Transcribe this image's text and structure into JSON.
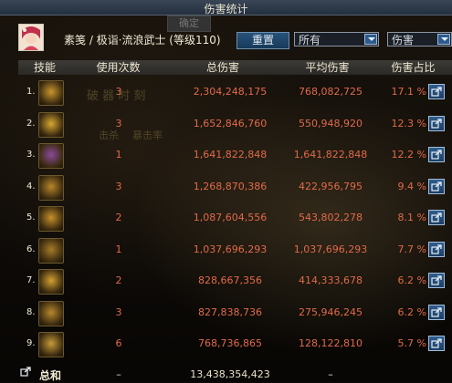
{
  "window": {
    "title": "伤害统计"
  },
  "ghost": {
    "confirm": "确定",
    "t1": "破 器 时 刻",
    "t2": "击杀",
    "t3": "暴击率"
  },
  "header": {
    "character": "素笺 / 极诣·流浪武士 (等级110)",
    "reset_label": "重置",
    "filter_selected": "所有",
    "type_selected": "伤害"
  },
  "columns": [
    "技能",
    "使用次数",
    "总伤害",
    "平均伤害",
    "伤害占比"
  ],
  "rows": [
    {
      "index": "1.",
      "count": "3",
      "total": "2,304,248,175",
      "avg": "768,082,725",
      "pct": "17.1 %",
      "icon": "skill-gold-slash-icon",
      "color": "#c9962e"
    },
    {
      "index": "2.",
      "count": "3",
      "total": "1,652,846,760",
      "avg": "550,948,920",
      "pct": "12.3 %",
      "icon": "skill-crescent-icon",
      "color": "#d8a833"
    },
    {
      "index": "3.",
      "count": "1",
      "total": "1,641,822,848",
      "avg": "1,641,822,848",
      "pct": "12.2 %",
      "icon": "skill-purple-burst-icon",
      "color": "#8a4a9a"
    },
    {
      "index": "4.",
      "count": "3",
      "total": "1,268,870,386",
      "avg": "422,956,795",
      "pct": "9.4 %",
      "icon": "skill-cross-slash-icon",
      "color": "#b8862a"
    },
    {
      "index": "5.",
      "count": "2",
      "total": "1,087,604,556",
      "avg": "543,802,278",
      "pct": "8.1 %",
      "icon": "skill-dash-icon",
      "color": "#c7902a"
    },
    {
      "index": "6.",
      "count": "1",
      "total": "1,037,696,293",
      "avg": "1,037,696,293",
      "pct": "7.7 %",
      "icon": "skill-swirl-icon",
      "color": "#a57a26"
    },
    {
      "index": "7.",
      "count": "2",
      "total": "828,667,356",
      "avg": "414,333,678",
      "pct": "6.2 %",
      "icon": "skill-palm-icon",
      "color": "#d4a030"
    },
    {
      "index": "8.",
      "count": "3",
      "total": "827,838,736",
      "avg": "275,946,245",
      "pct": "6.2 %",
      "icon": "skill-spin-icon",
      "color": "#b8882c"
    },
    {
      "index": "9.",
      "count": "6",
      "total": "768,736,865",
      "avg": "128,122,810",
      "pct": "5.7 %",
      "icon": "skill-claw-icon",
      "color": "#c59a38"
    }
  ],
  "total": {
    "label": "总和",
    "count": "–",
    "total": "13,438,354,423",
    "avg": "–"
  }
}
